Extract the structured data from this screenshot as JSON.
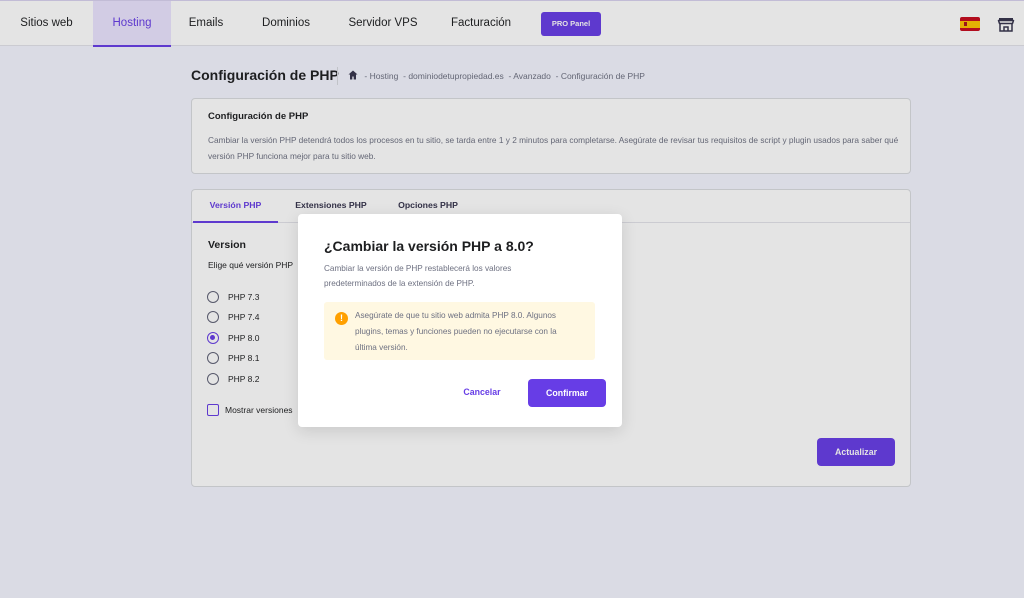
{
  "topnav": {
    "items": [
      {
        "label": "Sitios web"
      },
      {
        "label": "Hosting"
      },
      {
        "label": "Emails"
      },
      {
        "label": "Dominios"
      },
      {
        "label": "Servidor VPS"
      },
      {
        "label": "Facturación"
      }
    ],
    "active_item": "Hosting",
    "pro_panel_label": "PRO Panel",
    "language_icon": "spain-flag-icon",
    "store_icon": "store-icon"
  },
  "page": {
    "title": "Configuración de PHP",
    "breadcrumb": [
      "Hosting",
      "dominiodetupropiedad.es",
      "Avanzado",
      "Configuración de PHP"
    ]
  },
  "info": {
    "title": "Configuración de PHP",
    "text": "Cambiar la versión PHP detendrá todos los procesos en tu sitio, se tarda entre 1 y 2 minutos para completarse. Asegúrate de revisar tus requisitos de script y plugin usados para saber qué versión PHP funciona mejor para tu sitio web."
  },
  "tabs": [
    {
      "label": "Versión PHP"
    },
    {
      "label": "Extensiones PHP"
    },
    {
      "label": "Opciones PHP"
    }
  ],
  "version_section": {
    "title": "Version",
    "subtitle": "Elige qué versión PHP",
    "options": [
      {
        "label": "PHP 7.3",
        "checked": false
      },
      {
        "label": "PHP 7.4",
        "checked": false
      },
      {
        "label": "PHP 8.0",
        "checked": true
      },
      {
        "label": "PHP 8.1",
        "checked": false
      },
      {
        "label": "PHP 8.2",
        "checked": false
      }
    ],
    "show_versions_label": "Mostrar versiones",
    "update_button": "Actualizar"
  },
  "modal": {
    "title": "¿Cambiar la versión PHP a 8.0?",
    "description": "Cambiar la versión de PHP restablecerá los valores predeterminados de la extensión de PHP.",
    "warning": "Asegúrate de que tu sitio web admita PHP 8.0. Algunos plugins, temas y funciones pueden no ejecutarse con la última versión.",
    "cancel_label": "Cancelar",
    "confirm_label": "Confirmar"
  },
  "colors": {
    "accent": "#673de6",
    "warning_bg": "#fff8e2",
    "warning_icon": "#ffa000"
  }
}
